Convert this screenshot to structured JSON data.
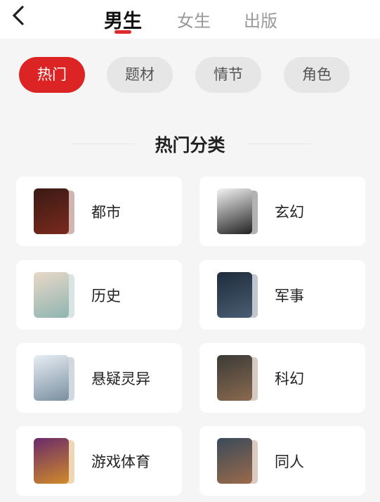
{
  "header": {
    "back_icon": "chevron-left-icon",
    "tabs": [
      {
        "label": "男生",
        "active": true
      },
      {
        "label": "女生",
        "active": false
      },
      {
        "label": "出版",
        "active": false
      }
    ]
  },
  "filters": [
    {
      "label": "热门",
      "active": true
    },
    {
      "label": "题材",
      "active": false
    },
    {
      "label": "情节",
      "active": false
    },
    {
      "label": "角色",
      "active": false
    }
  ],
  "section_title": "热门分类",
  "categories": [
    {
      "label": "都市",
      "cover_colors": [
        "#3a1a14",
        "#7a2a1e"
      ]
    },
    {
      "label": "玄幻",
      "cover_colors": [
        "#f4f4f4",
        "#222222"
      ]
    },
    {
      "label": "历史",
      "cover_colors": [
        "#e9d8c8",
        "#8fb5b0"
      ]
    },
    {
      "label": "军事",
      "cover_colors": [
        "#1e2c3c",
        "#4a5d72"
      ]
    },
    {
      "label": "悬疑灵异",
      "cover_colors": [
        "#e8eef4",
        "#7a8fa0"
      ]
    },
    {
      "label": "科幻",
      "cover_colors": [
        "#3b3a36",
        "#8a6a50"
      ]
    },
    {
      "label": "游戏体育",
      "cover_colors": [
        "#6a2a6a",
        "#d08a2a"
      ]
    },
    {
      "label": "同人",
      "cover_colors": [
        "#3a4a5a",
        "#9a6a4a"
      ]
    }
  ],
  "colors": {
    "accent": "#dd2424",
    "background": "#f5f5f5"
  }
}
